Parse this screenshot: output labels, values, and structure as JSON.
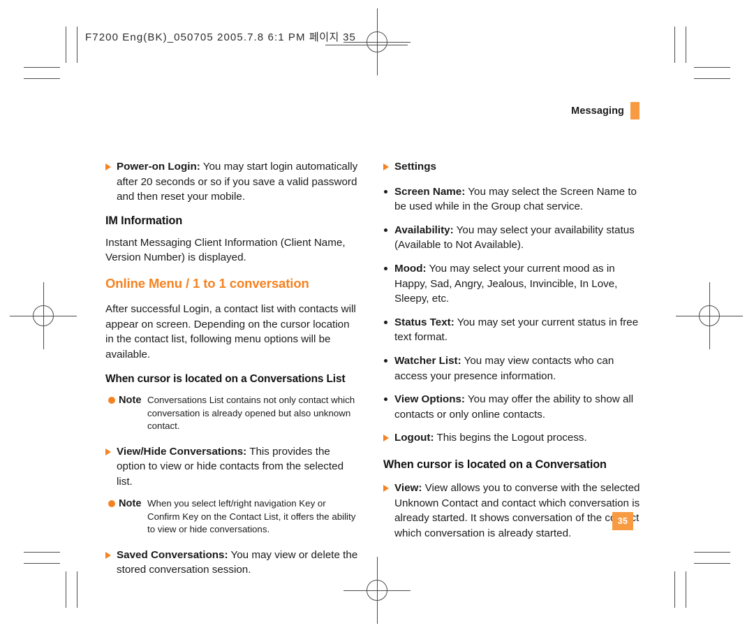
{
  "print_slug": {
    "text": "F7200 Eng(BK)_050705  2005.7.8  6:1 PM",
    "korean_page_label": "페이지",
    "page_number": "35"
  },
  "running_head": {
    "label": "Messaging",
    "accent_color": "#f89a41"
  },
  "page_badge": {
    "number": "35",
    "background": "#f89a41",
    "text_color": "#ffffff"
  },
  "left_column": {
    "power_on_login": {
      "lead": "Power-on Login:",
      "body": " You may start login automatically after 20 seconds or so if you save a valid password and then reset your mobile."
    },
    "im_information_heading": "IM Information",
    "im_information_body": "Instant Messaging Client Information (Client Name, Version Number) is displayed.",
    "online_menu_heading": "Online Menu / 1 to 1 conversation",
    "online_menu_body": "After successful Login, a contact list with contacts will appear on screen. Depending on the cursor location in the contact list, following menu options will be available.",
    "conversations_list_heading": "When cursor is located on a Conversations List",
    "note_1": {
      "label": "Note",
      "body": "Conversations List contains not only contact which conversation is already opened but also unknown contact."
    },
    "view_hide_conversations": {
      "lead": "View/Hide Conversations:",
      "body": " This provides the option to view or hide contacts from the selected list."
    },
    "note_2": {
      "label": "Note",
      "body": "When you select left/right navigation Key or Confirm Key on the Contact List, it offers the ability to view or hide conversations."
    },
    "saved_conversations": {
      "lead": "Saved Conversations:",
      "body": " You may view or delete the stored conversation session."
    }
  },
  "right_column": {
    "settings_heading": "Settings",
    "settings_items": [
      {
        "lead": "Screen Name:",
        "body": " You may select the Screen Name to be used while in the Group chat service."
      },
      {
        "lead": "Availability:",
        "body": " You may select your availability status (Available to Not Available)."
      },
      {
        "lead": "Mood:",
        "body": " You may select your current mood as in Happy, Sad, Angry, Jealous, Invincible, In Love, Sleepy, etc."
      },
      {
        "lead": "Status Text:",
        "body": " You may set your current status in free text format."
      },
      {
        "lead": "Watcher List:",
        "body": " You may view contacts who can access your presence information."
      },
      {
        "lead": "View Options:",
        "body": " You may offer the ability to show all contacts or only online contacts."
      }
    ],
    "logout": {
      "lead": "Logout:",
      "body": " This begins the Logout process."
    },
    "conversation_heading": "When cursor is located on a Conversation",
    "view": {
      "lead": "View:",
      "body": " View allows you to converse with the selected Unknown Contact and contact which conversation is already started. It shows conversation of the contact which conversation is already started."
    }
  }
}
